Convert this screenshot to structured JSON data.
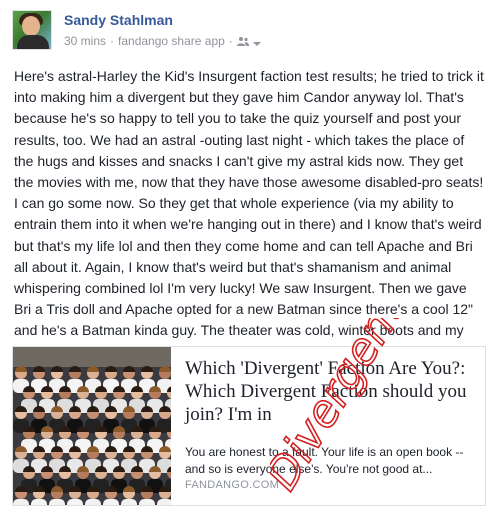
{
  "post": {
    "author": "Sandy Stahlman",
    "timestamp": "30 mins",
    "source": "fandango share app",
    "separator": "·",
    "audience_icon": "friends-icon",
    "menu_icon": "chevron-down-icon",
    "body": "Here's astral-Harley the Kid's Insurgent faction test results; he tried to trick it into making him a divergent but they gave him Candor anyway lol. That's because he's so happy to tell you to take the quiz yourself and post your results, too. We had an astral -outing last night - which takes the place of the hugs and kisses and snacks I can't give my astral kids now. They get the movies with me, now that they have those awesome disabled-pro seats! I can go some now. So they get that whole experience (via my ability to entrain them into it when we're hanging out in there) and I know that's weird but that's my life lol and then they come home and can tell Apache and Bri all about it. Again, I know that's weird but that's shamanism and animal whispering combined lol I'm very lucky! We saw Insurgent. Then we gave Bri a Tris doll and Apache opted for a new Batman since there's a cool 12\" and he's a Batman kinda guy. The theater was cold, winter boots and my gloves! It made me very happy. It was a really fun premiere! xo!"
  },
  "link_card": {
    "title": "Which 'Divergent' Faction Are You?: Which Divergent Faction should you join? I'm in",
    "description": "You are honest to a fault. Your life is an open book -- and so is everyone else's. You're not good at...",
    "domain": "FANDANGO.COM"
  },
  "overlay": {
    "handwriting": "Divergent!",
    "color": "#d42020"
  },
  "colors": {
    "author_blue": "#365899",
    "meta_gray": "#90949c",
    "border": "#dddfe2"
  }
}
